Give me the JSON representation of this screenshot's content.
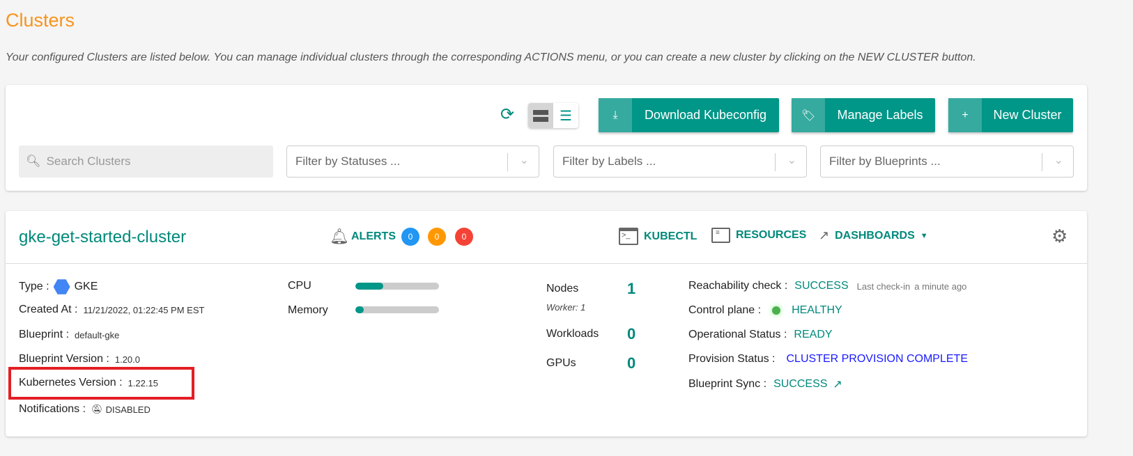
{
  "page": {
    "title": "Clusters",
    "description": "Your configured Clusters are listed below. You can manage individual clusters through the corresponding ACTIONS menu, or you can create a new cluster by clicking on the NEW CLUSTER button."
  },
  "toolbar": {
    "download": "Download Kubeconfig",
    "labels": "Manage Labels",
    "new": "New Cluster",
    "view_mode": "card"
  },
  "filters": {
    "search_placeholder": "Search Clusters",
    "statuses": "Filter by Statuses ...",
    "labels": "Filter by Labels ...",
    "blueprints": "Filter by Blueprints ..."
  },
  "cluster": {
    "name": "gke-get-started-cluster",
    "alerts": {
      "label": "ALERTS",
      "counts": [
        "0",
        "0",
        "0"
      ],
      "colors": [
        "#2196f3",
        "#ff9800",
        "#f44336"
      ]
    },
    "actions": {
      "kubectl": "KUBECTL",
      "resources": "RESOURCES",
      "dashboards": "DASHBOARDS"
    },
    "info": {
      "type_label": "Type :",
      "type": "GKE",
      "created_label": "Created At :",
      "created": "11/21/2022, 01:22:45 PM EST",
      "blueprint_label": "Blueprint :",
      "blueprint": "default-gke",
      "bp_version_label": "Blueprint Version :",
      "bp_version": "1.20.0",
      "k8s_label": "Kubernetes Version :",
      "k8s": "1.22.15",
      "notif_label": "Notifications :",
      "notif": "DISABLED"
    },
    "usage": {
      "cpu_label": "CPU",
      "cpu_percent": 33,
      "mem_label": "Memory",
      "mem_percent": 10
    },
    "counts": {
      "nodes_label": "Nodes",
      "nodes": "1",
      "worker": "Worker: 1",
      "workloads_label": "Workloads",
      "workloads": "0",
      "gpus_label": "GPUs",
      "gpus": "0"
    },
    "status": {
      "reach_label": "Reachability check :",
      "reach": "SUCCESS",
      "checkin_label": "Last check-in",
      "checkin": "a minute ago",
      "cp_label": "Control plane :",
      "cp": "HEALTHY",
      "op_label": "Operational Status :",
      "op": "READY",
      "prov_label": "Provision Status :",
      "prov": "CLUSTER PROVISION COMPLETE",
      "sync_label": "Blueprint Sync :",
      "sync": "SUCCESS"
    }
  },
  "colors": {
    "accent": "#009688",
    "title": "#f7941d",
    "highlight": "#e31e24"
  }
}
